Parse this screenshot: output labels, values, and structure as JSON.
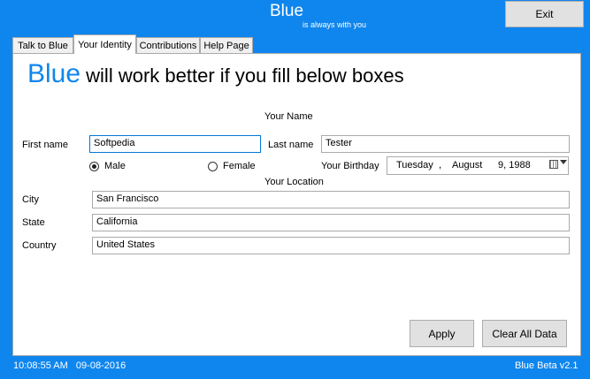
{
  "header": {
    "title": "Blue",
    "subtitle": "is always with you",
    "exit_label": "Exit"
  },
  "tabs": [
    {
      "label": "Talk to Blue",
      "active": false
    },
    {
      "label": "Your Identity",
      "active": true
    },
    {
      "label": "Contributions",
      "active": false
    },
    {
      "label": "Help Page",
      "active": false
    }
  ],
  "identity": {
    "heading_accent": "Blue",
    "heading_rest": " will work better if you fill below boxes",
    "your_name_label": "Your Name",
    "first_name_label": "First name",
    "first_name_value": "Softpedia",
    "last_name_label": "Last name",
    "last_name_value": "Tester",
    "gender_options": [
      {
        "label": "Male",
        "checked": true
      },
      {
        "label": "Female",
        "checked": false
      }
    ],
    "birthday_label": "Your Birthday",
    "birthday": {
      "weekday": "Tuesday",
      "sep": ",",
      "month": "August",
      "day_year": "9, 1988"
    },
    "your_location_label": "Your Location",
    "city_label": "City",
    "city_value": "San Francisco",
    "state_label": "State",
    "state_value": "California",
    "country_label": "Country",
    "country_value": "United States",
    "apply_label": "Apply",
    "clear_label": "Clear All Data"
  },
  "status": {
    "datetime": "10:08:55 AM   09-08-2016",
    "version": "Blue Beta v2.1"
  },
  "colors": {
    "accent": "#0f86ee",
    "button_face": "#e1e1e1",
    "focus_border": "#0078d7"
  }
}
